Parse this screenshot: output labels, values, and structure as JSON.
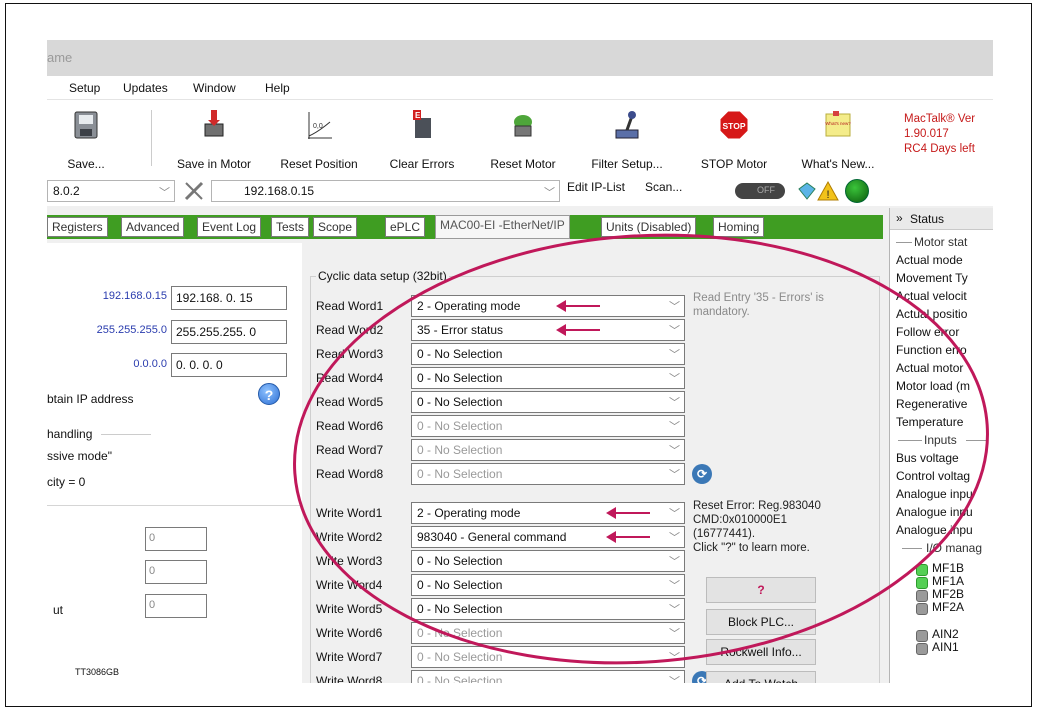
{
  "window": {
    "title_fragment": "ame"
  },
  "menu": [
    "Setup",
    "Updates",
    "Window",
    "Help"
  ],
  "toolbar": {
    "buttons": [
      {
        "label": "Save...",
        "icon": "save-disk-icon"
      },
      {
        "label": "Save in Motor",
        "icon": "save-in-motor-icon"
      },
      {
        "label": "Reset Position",
        "icon": "reset-position-icon"
      },
      {
        "label": "Clear Errors",
        "icon": "clear-errors-icon"
      },
      {
        "label": "Reset Motor",
        "icon": "reset-motor-icon"
      },
      {
        "label": "Filter Setup...",
        "icon": "joystick-icon"
      },
      {
        "label": "STOP Motor",
        "icon": "stop-sign-icon",
        "icon_text": "STOP"
      },
      {
        "label": "What's New...",
        "icon": "sticky-note-icon",
        "icon_text": "What's new?"
      }
    ],
    "version_lines": [
      "MacTalk® Ver",
      "1.90.017",
      "RC4 Days left"
    ]
  },
  "address_bar": {
    "left_combo_value": "8.0.2",
    "ip_combo_value": "192.168.0.15",
    "edit_ip_list": "Edit IP-List",
    "scan": "Scan...",
    "toggle_label": "OFF"
  },
  "tabs": [
    "Registers",
    "Advanced",
    "Event Log",
    "Tests",
    "Scope",
    "ePLC",
    "MAC00-EI -EtherNet/IP",
    "Units (Disabled)",
    "Homing"
  ],
  "selected_tab": "MAC00-EI -EtherNet/IP",
  "left": {
    "ip_rows": [
      {
        "current": "192.168.0.15",
        "entry": "192.168.  0. 15"
      },
      {
        "current": "255.255.255.0",
        "entry": "255.255.255.  0"
      },
      {
        "current": "0.0.0.0",
        "entry": "  0.  0.  0.  0"
      }
    ],
    "obtain_ip": "btain IP address",
    "handling": "handling",
    "passive_mode": "ssive mode\"",
    "velocity": "city = 0",
    "small_boxes": [
      "0",
      "0",
      "0"
    ],
    "out_label": "ut",
    "footer_code": "TT3086GB"
  },
  "cyclic": {
    "title": "Cyclic data setup (32bit)",
    "read_words": [
      {
        "label": "Read Word1",
        "value": "2 - Operating mode",
        "enabled": true
      },
      {
        "label": "Read Word2",
        "value": "35 - Error status",
        "enabled": true
      },
      {
        "label": "Read Word3",
        "value": "0 - No Selection",
        "enabled": true
      },
      {
        "label": "Read Word4",
        "value": "0 - No Selection",
        "enabled": true
      },
      {
        "label": "Read Word5",
        "value": "0 - No Selection",
        "enabled": true
      },
      {
        "label": "Read Word6",
        "value": "0 - No Selection",
        "enabled": false
      },
      {
        "label": "Read Word7",
        "value": "0 - No Selection",
        "enabled": false
      },
      {
        "label": "Read Word8",
        "value": "0 - No Selection",
        "enabled": false
      }
    ],
    "write_words": [
      {
        "label": "Write Word1",
        "value": "2 - Operating mode",
        "enabled": true
      },
      {
        "label": "Write Word2",
        "value": "983040 - General command",
        "enabled": true
      },
      {
        "label": "Write Word3",
        "value": "0 - No Selection",
        "enabled": true
      },
      {
        "label": "Write Word4",
        "value": "0 - No Selection",
        "enabled": true
      },
      {
        "label": "Write Word5",
        "value": "0 - No Selection",
        "enabled": true
      },
      {
        "label": "Write Word6",
        "value": "0 - No Selection",
        "enabled": false
      },
      {
        "label": "Write Word7",
        "value": "0 - No Selection",
        "enabled": false
      },
      {
        "label": "Write Word8",
        "value": "0 - No Selection",
        "enabled": false
      }
    ],
    "read_note": "Read Entry '35 - Errors' is mandatory.",
    "write_note_lines": [
      "Reset Error: Reg.983040",
      "CMD:0x010000E1",
      "(16777441).",
      "Click \"?\" to learn more."
    ],
    "help_button": "?",
    "block_plc": "Block PLC...",
    "rockwell_info": "Rockwell Info...",
    "add_to_watch": "Add To Watch"
  },
  "status_panel": {
    "header": "Status",
    "motor_section": "Motor stat",
    "items": [
      "Actual mode",
      "Movement Ty",
      "Actual velocit",
      "Actual positio",
      "Follow error",
      "Function erro",
      "Actual motor",
      "Motor load (m",
      "Regenerative",
      "Temperature"
    ],
    "inputs_section": "Inputs",
    "inputs": [
      "Bus voltage",
      "Control voltag",
      "Analogue inpu",
      "Analogue inpu",
      "Analogue inpu"
    ],
    "io_section": "I/O manag",
    "io": [
      {
        "label": "MF1B",
        "state": "on"
      },
      {
        "label": "MF1A",
        "state": "on"
      },
      {
        "label": "MF2B",
        "state": "off"
      },
      {
        "label": "MF2A",
        "state": "off"
      },
      {
        "label": "AIN2",
        "state": "off"
      },
      {
        "label": "AIN1",
        "state": "off"
      }
    ]
  },
  "colors": {
    "annotation": "#c0185a",
    "tab_strip": "#3f9d22",
    "version": "#c61a1a"
  }
}
